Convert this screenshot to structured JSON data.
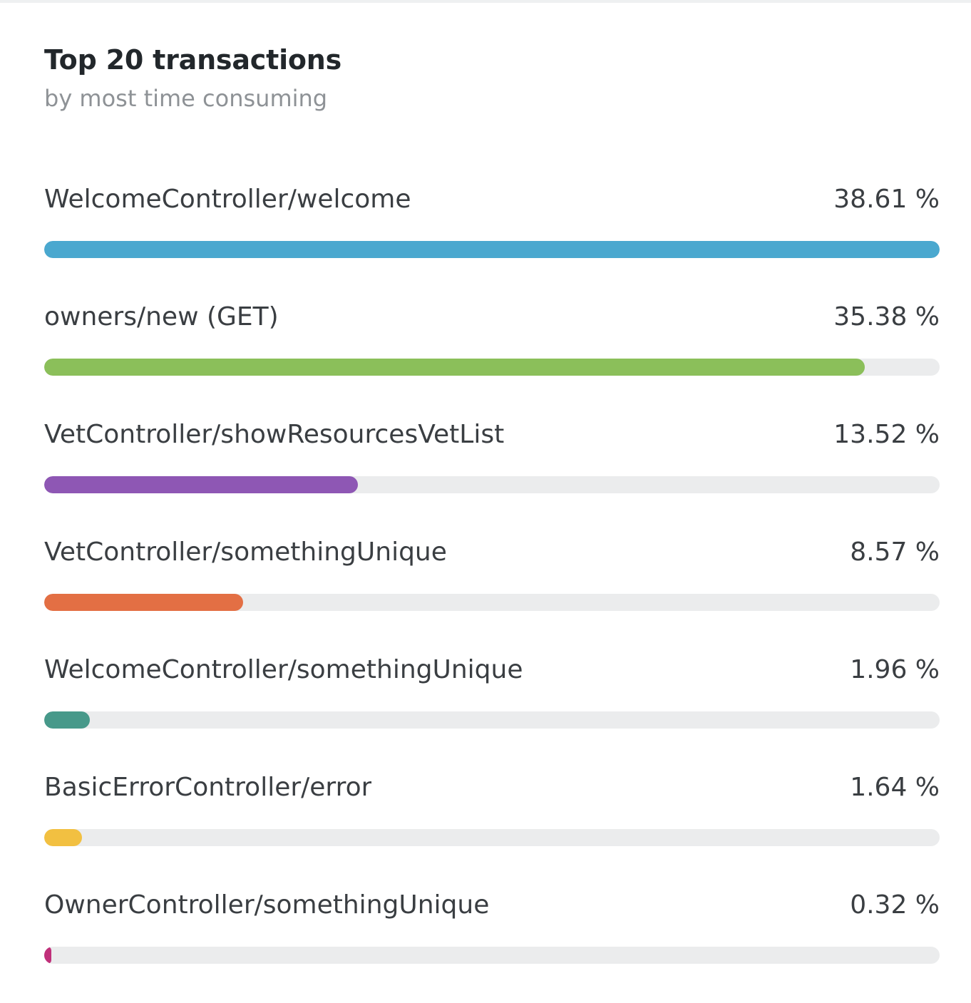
{
  "panel": {
    "title": "Top 20 transactions",
    "subtitle": "by most time consuming"
  },
  "transactions": [
    {
      "name": "WelcomeController/welcome",
      "percent_label": "38.61 %",
      "percent": 38.61,
      "color": "#4aa8cf"
    },
    {
      "name": "owners/new (GET)",
      "percent_label": "35.38 %",
      "percent": 35.38,
      "color": "#8bbf5a"
    },
    {
      "name": "VetController/showResourcesVetList",
      "percent_label": "13.52 %",
      "percent": 13.52,
      "color": "#8e57b4"
    },
    {
      "name": "VetController/somethingUnique",
      "percent_label": "8.57 %",
      "percent": 8.57,
      "color": "#e36f44"
    },
    {
      "name": "WelcomeController/somethingUnique",
      "percent_label": "1.96 %",
      "percent": 1.96,
      "color": "#47998a"
    },
    {
      "name": "BasicErrorController/error",
      "percent_label": "1.64 %",
      "percent": 1.64,
      "color": "#f2c041"
    },
    {
      "name": "OwnerController/somethingUnique",
      "percent_label": "0.32 %",
      "percent": 0.32,
      "color": "#c0307a"
    }
  ]
}
